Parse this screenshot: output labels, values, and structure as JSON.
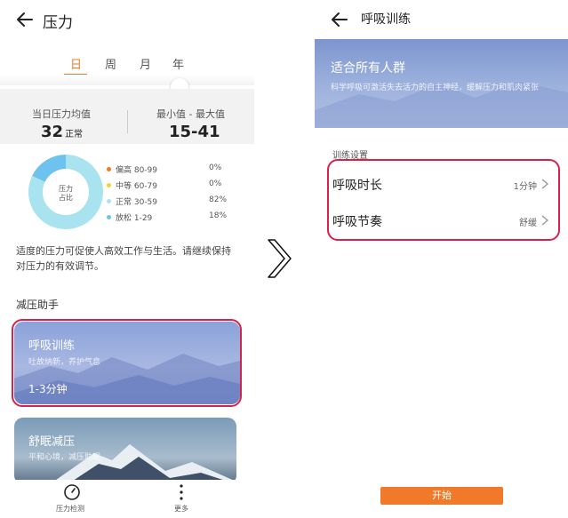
{
  "left": {
    "header": {
      "title": "压力"
    },
    "tabs": [
      {
        "label": "日",
        "active": true
      },
      {
        "label": "周",
        "active": false
      },
      {
        "label": "月",
        "active": false
      },
      {
        "label": "年",
        "active": false
      }
    ],
    "stats": {
      "avg_label": "当日压力均值",
      "avg_value": "32",
      "avg_unit": "正常",
      "range_label": "最小值 - 最大值",
      "range_value": "15-41"
    },
    "donut": {
      "center_line1": "压力",
      "center_line2": "占比",
      "segments": [
        {
          "label": "偏高 80-99",
          "percent": "0%",
          "value": 0,
          "color": "#f07a2a"
        },
        {
          "label": "中等 60-79",
          "percent": "0%",
          "value": 0,
          "color": "#f5d23a"
        },
        {
          "label": "正常 30-59",
          "percent": "82%",
          "value": 82,
          "color": "#a9e3f0"
        },
        {
          "label": "放松 1-29",
          "percent": "18%",
          "value": 18,
          "color": "#6ec3ee"
        }
      ]
    },
    "advice": "适度的压力可促使人高效工作与生活。请继续保持对压力的有效调节。",
    "section_title": "减压助手",
    "cards": [
      {
        "title": "呼吸训练",
        "subtitle": "吐故纳新，养护气息",
        "duration": "1-3分钟"
      },
      {
        "title": "舒眠减压",
        "subtitle": "平和心境，减压助眠"
      }
    ],
    "bottom_nav": [
      {
        "label": "压力检测",
        "icon": "gauge-icon"
      },
      {
        "label": "更多",
        "icon": "more-icon"
      }
    ]
  },
  "right": {
    "header": {
      "title": "呼吸训练"
    },
    "banner": {
      "title": "适合所有人群",
      "description": "科学呼吸可激活失去活力的自主神经，缓解压力和肌肉紧张"
    },
    "section_title": "训练设置",
    "settings": [
      {
        "label": "呼吸时长",
        "value": "1分钟"
      },
      {
        "label": "呼吸节奏",
        "value": "舒缓"
      }
    ],
    "start_button": "开始"
  },
  "colors": {
    "accent": "#f07a2a",
    "highlight": "#d9214a"
  }
}
